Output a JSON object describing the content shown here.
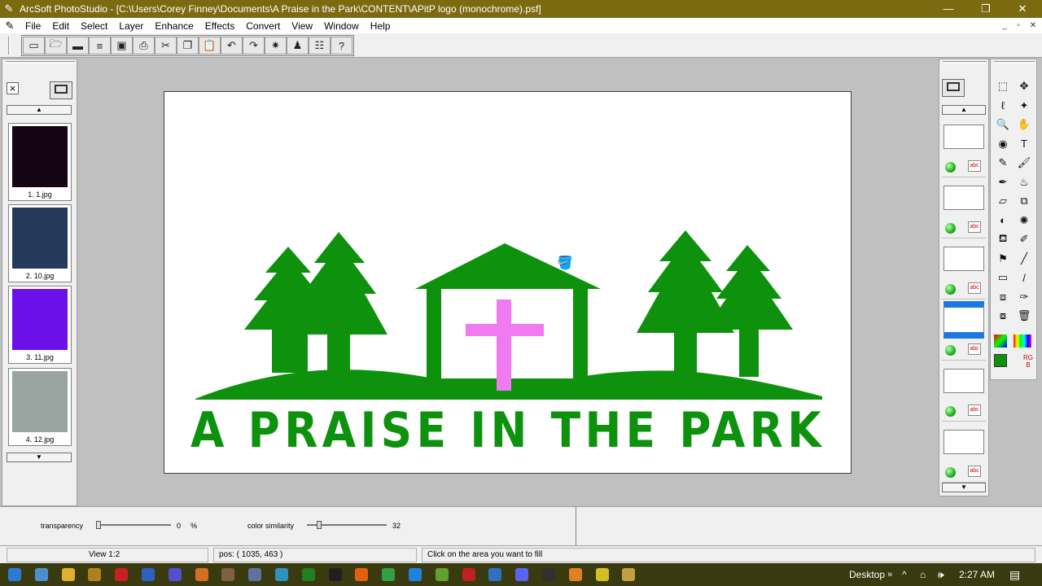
{
  "window": {
    "title": "ArcSoft PhotoStudio - [C:\\Users\\Corey Finney\\Documents\\A Praise in the Park\\CONTENT\\APitP logo (monochrome).psf]",
    "minimize": "—",
    "restore": "❐",
    "close": "✕"
  },
  "menu": {
    "items": [
      "File",
      "Edit",
      "Select",
      "Layer",
      "Enhance",
      "Effects",
      "Convert",
      "View",
      "Window",
      "Help"
    ],
    "mdi_min": "_",
    "mdi_restore": "▫",
    "mdi_close": "✕"
  },
  "toolbar": {
    "icons": [
      "new-icon",
      "open-icon",
      "scan-icon",
      "print-preview-icon",
      "save-icon",
      "print-icon",
      "cut-icon",
      "copy-icon",
      "paste-icon",
      "undo-icon",
      "redo-icon",
      "magic-icon",
      "stamp-icon",
      "settings-icon",
      "help-icon"
    ],
    "glyphs": [
      "▭",
      "🗁",
      "▬",
      "≡",
      "▣",
      "⎙",
      "✂",
      "❐",
      "📋",
      "↶",
      "↷",
      "✷",
      "♟",
      "☷",
      "?"
    ]
  },
  "album": {
    "close": "×",
    "thumbnails": [
      {
        "caption": "1. 1.jpg",
        "color": "#140414"
      },
      {
        "caption": "2. 10.jpg",
        "color": "#253a5a"
      },
      {
        "caption": "3. 11.jpg",
        "color": "#6a10e8"
      },
      {
        "caption": "4. 12.jpg",
        "color": "#9aa4a0"
      }
    ]
  },
  "canvas": {
    "text": "A PRAISE IN THE PARK",
    "green": "#0e920e",
    "pink": "#f07af0"
  },
  "layers": {
    "count": 6,
    "selected_index": 3,
    "text_icon": "abc"
  },
  "tools": {
    "icons": [
      "rect-select-icon",
      "move-icon",
      "lasso-icon",
      "magic-wand-icon",
      "zoom-icon",
      "hand-icon",
      "red-eye-icon",
      "text-icon",
      "pencil-icon",
      "brush-icon",
      "airbrush-icon",
      "spray-icon",
      "eraser-icon",
      "clone-icon",
      "dodge-icon",
      "smudge-icon",
      "fill-icon",
      "color-picker-icon",
      "stamp-tool-icon",
      "pen-icon",
      "gradient-icon",
      "line-icon",
      "crop-icon",
      "dropper-icon",
      "transform-icon",
      "trash-icon"
    ],
    "glyphs": [
      "⬚",
      "✥",
      "ℓ",
      "✦",
      "🔍",
      "✋",
      "◉",
      "T",
      "✎",
      "🖌",
      "✒",
      "♨",
      "▱",
      "⧉",
      "◐",
      "✺",
      "⛾",
      "✐",
      "⚑",
      "╱",
      "▭",
      "/",
      "⧈",
      "✑",
      "⧇",
      "🗑"
    ],
    "rgb": "RGB"
  },
  "options": {
    "transparency_label": "transparency",
    "transparency_value": "0",
    "transparency_unit": "%",
    "color_similarity_label": "color similarity",
    "color_similarity_value": "32"
  },
  "status": {
    "view": "View 1:2",
    "pos": "pos: ( 1035, 463 )",
    "hint": "Click on the area you want to fill"
  },
  "taskbar": {
    "desktop": "Desktop",
    "chevron": "»",
    "time": "2:27 AM"
  }
}
